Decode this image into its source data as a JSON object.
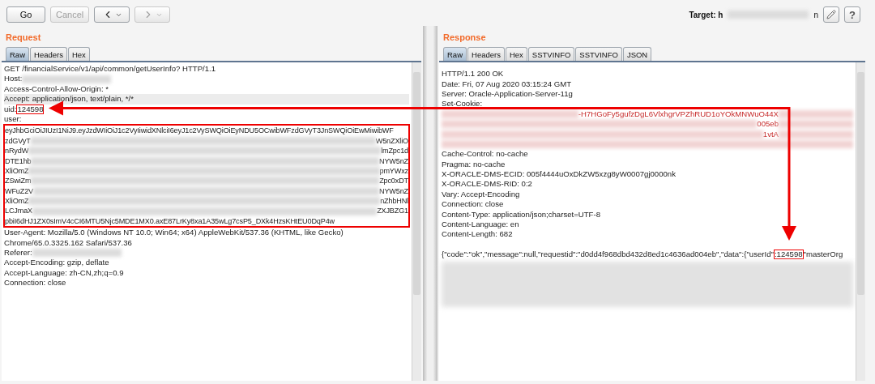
{
  "toolbar": {
    "buttons": [
      {
        "label": "Go",
        "disabled": false
      },
      {
        "label": "Cancel",
        "disabled": true
      }
    ],
    "nav": [
      {
        "kind": "back",
        "disabled": false
      },
      {
        "kind": "forward",
        "disabled": true
      }
    ],
    "target_label": "Target: h",
    "target_tail": "n",
    "help_label": "?"
  },
  "request": {
    "title": "Request",
    "tabs": [
      {
        "label": "Raw",
        "selected": true
      },
      {
        "label": "Headers",
        "selected": false
      },
      {
        "label": "Hex",
        "selected": false
      }
    ],
    "lines": [
      {
        "kind": "text",
        "text": "GET /financialService/v1/api/common/getUserInfo? HTTP/1.1"
      },
      {
        "kind": "text",
        "text": "Host:",
        "redacted": true
      },
      {
        "kind": "text",
        "text": "Access-Control-Allow-Origin: *"
      },
      {
        "kind": "current",
        "text": "Accept: application/json, text/plain, */*"
      },
      {
        "kind": "boxed",
        "text": "uid:",
        "boxed": "124598"
      },
      {
        "kind": "text",
        "text": "user:"
      },
      {
        "kind": "token",
        "lines": [
          {
            "text": "eyJhbGciOiJIUzI1NiJ9.eyJzdWIiOiJ1c2VyIiwidXNlciI6eyJ1c2VySWQiOiEyNDU5OCwibWFzdGVyT3JnSWQiOiEwMiwibWF"
          },
          {
            "start": "zdGVyT",
            "end": "W5nZXliO"
          },
          {
            "start": "nRydW",
            "end": "lmZpc1d"
          },
          {
            "start": "DTE1hb",
            "end": "NYW5nZ"
          },
          {
            "start": "XliOmZ",
            "end": "pmYWxz"
          },
          {
            "start": "ZSwiZm",
            "end": "Zpc0xDT"
          },
          {
            "start": "WFuZ2V",
            "end": "NYW5nZ"
          },
          {
            "start": "XliOmZ",
            "end": "nZhbHNl"
          },
          {
            "start": "LCJmaX",
            "end": "ZXJBZG1"
          },
          {
            "text": "pbiI6dHJ1ZX0sImV4cCI6MTU5Njc5MDE1MX0.axE87LrKy8xa1A35wLg7csP5_DXk4HzsKHtEU0DqP4w"
          }
        ]
      },
      {
        "kind": "text",
        "text": "User-Agent: Mozilla/5.0 (Windows NT 10.0; Win64; x64) AppleWebKit/537.36 (KHTML, like Gecko)"
      },
      {
        "kind": "text",
        "text": "Chrome/65.0.3325.162 Safari/537.36"
      },
      {
        "kind": "text",
        "text": "Referer:",
        "redacted": true
      },
      {
        "kind": "text",
        "text": "Accept-Encoding: gzip, deflate"
      },
      {
        "kind": "text",
        "text": "Accept-Language: zh-CN,zh;q=0.9"
      },
      {
        "kind": "text",
        "text": "Connection: close"
      }
    ]
  },
  "response": {
    "title": "Response",
    "tabs": [
      {
        "label": "Raw",
        "selected": true
      },
      {
        "label": "Headers",
        "selected": false
      },
      {
        "label": "Hex",
        "selected": false
      },
      {
        "label": "SSTVINFO",
        "selected": false
      },
      {
        "label": "SSTVINFO",
        "selected": false
      },
      {
        "label": "JSON",
        "selected": false
      }
    ],
    "lines": [
      {
        "kind": "text",
        "text": "HTTP/1.1 200 OK"
      },
      {
        "kind": "text",
        "text": "Date: Fri, 07 Aug 2020 03:15:24 GMT"
      },
      {
        "kind": "text",
        "text": "Server: Oracle-Application-Server-11g"
      },
      {
        "kind": "text",
        "text": "Set-Cookie:"
      },
      {
        "kind": "cookie",
        "text": "-H7HGoFy5gufzDgL6VlxhgrVPZhRUD1oYOkMNWuO44X"
      },
      {
        "kind": "cookie",
        "text": "005eb"
      },
      {
        "kind": "cookie",
        "text": "1vtA"
      },
      {
        "kind": "cookie"
      },
      {
        "kind": "text",
        "text": "Cache-Control: no-cache"
      },
      {
        "kind": "text",
        "text": "Pragma: no-cache"
      },
      {
        "kind": "text",
        "text": "X-ORACLE-DMS-ECID: 005f4444uOxDkZW5xzg8yW0007gj0000nk"
      },
      {
        "kind": "text",
        "text": "X-ORACLE-DMS-RID: 0:2"
      },
      {
        "kind": "text",
        "text": "Vary: Accept-Encoding"
      },
      {
        "kind": "text",
        "text": "Connection: close"
      },
      {
        "kind": "text",
        "text": "Content-Type: application/json;charset=UTF-8"
      },
      {
        "kind": "text",
        "text": "Content-Language: en"
      },
      {
        "kind": "text",
        "text": "Content-Length: 682"
      },
      {
        "kind": "blank"
      },
      {
        "kind": "boxed",
        "text": "{\"code\":\"ok\",\"message\":null,\"requestid\":\"d0dd4f968dbd432d8ed1c4636ad004eb\",\"data\":{\"userId\"",
        "boxed": ":124598",
        "tail": "\"masterOrg"
      },
      {
        "kind": "redacted_block"
      }
    ]
  }
}
